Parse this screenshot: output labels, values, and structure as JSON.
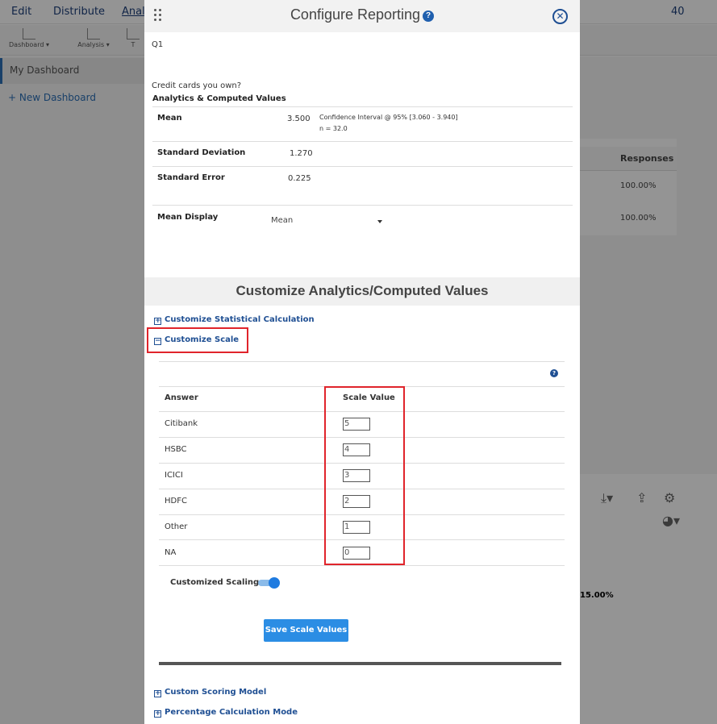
{
  "background": {
    "nav": [
      "Edit",
      "Distribute",
      "Analy"
    ],
    "toolbar": [
      "Dashboard",
      "Analysis",
      "T"
    ],
    "sidebar": {
      "my_dashboard": "My Dashboard",
      "new_dashboard": "+ New Dashboard"
    },
    "user_count": "40",
    "table_header": "Responses",
    "table_values": [
      "100.00%",
      "100.00%"
    ],
    "chart_value": "15.00%"
  },
  "modal": {
    "title": "Configure Reporting",
    "question_label": "Q1",
    "question_text": "Credit cards you own?",
    "analytics_heading": "Analytics & Computed Values",
    "mean_label": "Mean",
    "mean_value": "3.500",
    "confidence_interval": "Confidence Interval @ 95% [3.060 - 3.940]",
    "n_value": "n = 32.0",
    "std_dev_label": "Standard Deviation",
    "std_dev_value": "1.270",
    "std_err_label": "Standard Error",
    "std_err_value": "0.225",
    "mean_display_label": "Mean Display",
    "mean_display_value": "Mean",
    "customize_heading": "Customize Analytics/Computed Values",
    "accordion": {
      "statistical": "Customize Statistical Calculation",
      "scale": "Customize Scale",
      "scoring": "Custom Scoring Model",
      "percentage": "Percentage Calculation Mode"
    },
    "scale_table": {
      "answer_header": "Answer",
      "value_header": "Scale Value",
      "rows": [
        {
          "answer": "Citibank",
          "value": "5"
        },
        {
          "answer": "HSBC",
          "value": "4"
        },
        {
          "answer": "ICICI",
          "value": "3"
        },
        {
          "answer": "HDFC",
          "value": "2"
        },
        {
          "answer": "Other",
          "value": "1"
        },
        {
          "answer": "NA",
          "value": "0"
        }
      ]
    },
    "customized_scaling_label": "Customized Scaling",
    "customized_scaling_on": true,
    "save_button": "Save Scale Values"
  },
  "colors": {
    "accent": "#1f4f93",
    "button": "#2b8de4",
    "highlight": "#e0242b"
  }
}
